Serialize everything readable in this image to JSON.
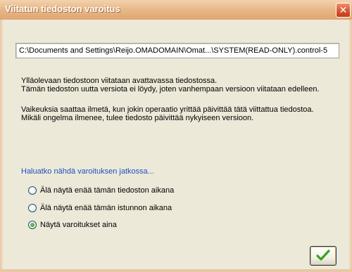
{
  "window": {
    "title": "Viitatun tiedoston varoitus",
    "close_glyph": "✕"
  },
  "path": "C:\\Documents and Settings\\Reijo.OMADOMAIN\\Omat...\\SYSTEM(READ-ONLY).control-5",
  "messages": {
    "line1": "Ylläolevaan tiedostoon viitataan avattavassa tiedostossa.",
    "line2": "Tämän tiedoston uutta versiota ei löydy, joten vanhempaan versioon viitataan edelleen.",
    "line3": "Vaikeuksia saattaa ilmetä, kun jokin operaatio yrittää päivittää tätä viittattua tiedostoa.",
    "line4": "Mikäli ongelma ilmenee, tulee tiedosto päivittää nykyiseen versioon."
  },
  "question": "Haluatko nähdä varoituksen jatkossa...",
  "options": [
    {
      "label": "Älä näytä enää tämän tiedoston aikana",
      "selected": false
    },
    {
      "label": "Älä näytä enää tämän istunnon aikana",
      "selected": false
    },
    {
      "label": "Näytä varoitukset aina",
      "selected": true
    }
  ],
  "ok_button": {
    "icon": "checkmark-icon"
  },
  "colors": {
    "title_bar": "#e0a672",
    "question_text": "#1f4fc4",
    "client_bg": "#ece9d8",
    "check_green": "#3aa318"
  }
}
